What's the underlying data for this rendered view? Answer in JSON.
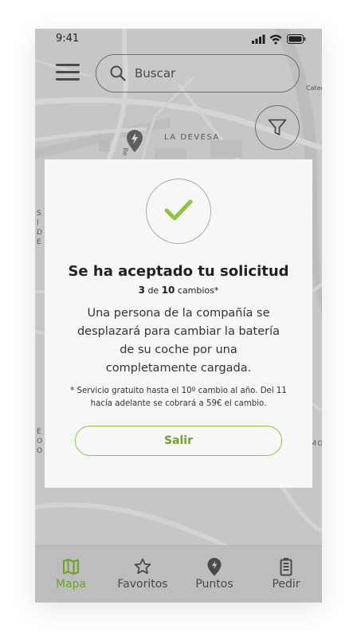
{
  "status_bar": {
    "time": "9:41"
  },
  "search": {
    "placeholder": "Buscar",
    "value": ""
  },
  "map": {
    "labels": {
      "district": "LA DEVESA",
      "top_right": "Cated",
      "left_stack": [
        "S",
        "I",
        "D",
        "E"
      ],
      "left_stack_2": [
        "E",
        "O",
        "O"
      ],
      "right_edge": "MO",
      "street": "Re"
    }
  },
  "modal": {
    "title": "Se ha aceptado tu solicitud",
    "counter": {
      "current": "3",
      "connector": "de",
      "total": "10",
      "unit": "cambios*"
    },
    "body": "Una persona de la compañía se desplazará para cambiar la batería de su coche por una completamente cargada.",
    "note": "* Servicio gratuito hasta el 10º cambio al año. Del 11 hacía adelante se cobrará a 59€ el cambio.",
    "exit_label": "Salir"
  },
  "tabs": [
    {
      "label": "Mapa",
      "icon": "map-icon",
      "active": true
    },
    {
      "label": "Favoritos",
      "icon": "star-icon",
      "active": false
    },
    {
      "label": "Puntos",
      "icon": "location-pin-icon",
      "active": false
    },
    {
      "label": "Pedir",
      "icon": "battery-icon",
      "active": false
    }
  ],
  "colors": {
    "accent": "#8cc63f",
    "accent_text": "#6fa22a",
    "map_bg": "#c6c6c6",
    "modal_bg": "#f7f7f7"
  }
}
